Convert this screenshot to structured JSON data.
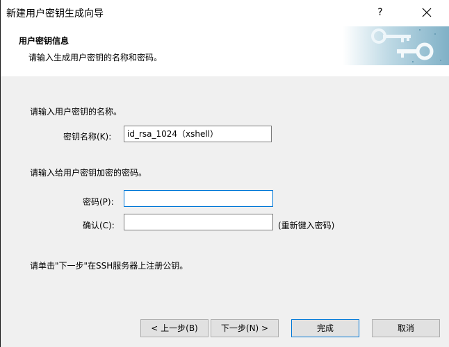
{
  "window": {
    "title": "新建用户密钥生成向导",
    "help_label": "?"
  },
  "header": {
    "title": "用户密钥信息",
    "subtitle": "请输入生成用户密钥的名称和密码。"
  },
  "form": {
    "name_prompt": "请输入用户密钥的名称。",
    "name_label": "密钥名称(K):",
    "name_value": "id_rsa_1024（xshell）",
    "password_prompt": "请输入给用户密钥加密的密码。",
    "password_label": "密码(P):",
    "password_value": "",
    "confirm_label": "确认(C):",
    "confirm_value": "",
    "confirm_hint": "(重新键入密码)",
    "footer_note": "请单击\"下一步\"在SSH服务器上注册公钥。"
  },
  "buttons": {
    "back": "< 上一步(B)",
    "next": "下一步(N) >",
    "finish": "完成",
    "cancel": "取消"
  }
}
